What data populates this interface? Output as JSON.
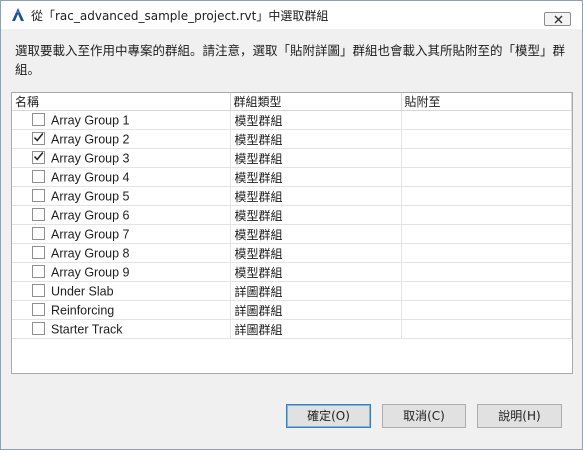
{
  "window": {
    "title": "從「rac_advanced_sample_project.rvt」中選取群組"
  },
  "instruction": "選取要載入至作用中專案的群組。請注意，選取「貼附詳圖」群組也會載入其所貼附至的「模型」群組。",
  "table": {
    "columns": [
      "名稱",
      "群組類型",
      "貼附至"
    ],
    "rows": [
      {
        "name": "Array Group 1",
        "type": "模型群組",
        "attached": "",
        "checked": false
      },
      {
        "name": "Array Group 2",
        "type": "模型群組",
        "attached": "",
        "checked": true
      },
      {
        "name": "Array Group 3",
        "type": "模型群組",
        "attached": "",
        "checked": true
      },
      {
        "name": "Array Group 4",
        "type": "模型群組",
        "attached": "",
        "checked": false
      },
      {
        "name": "Array Group 5",
        "type": "模型群組",
        "attached": "",
        "checked": false
      },
      {
        "name": "Array Group 6",
        "type": "模型群組",
        "attached": "",
        "checked": false
      },
      {
        "name": "Array Group 7",
        "type": "模型群組",
        "attached": "",
        "checked": false
      },
      {
        "name": "Array Group 8",
        "type": "模型群組",
        "attached": "",
        "checked": false
      },
      {
        "name": "Array Group 9",
        "type": "模型群組",
        "attached": "",
        "checked": false
      },
      {
        "name": "Under Slab",
        "type": "詳圖群組",
        "attached": "",
        "checked": false
      },
      {
        "name": "Reinforcing",
        "type": "詳圖群組",
        "attached": "",
        "checked": false
      },
      {
        "name": "Starter Track",
        "type": "詳圖群組",
        "attached": "",
        "checked": false
      }
    ]
  },
  "buttons": {
    "ok": "確定(O)",
    "cancel": "取消(C)",
    "help": "說明(H)"
  },
  "icons": {
    "app": "revit-logo-icon",
    "close": "close-icon"
  }
}
